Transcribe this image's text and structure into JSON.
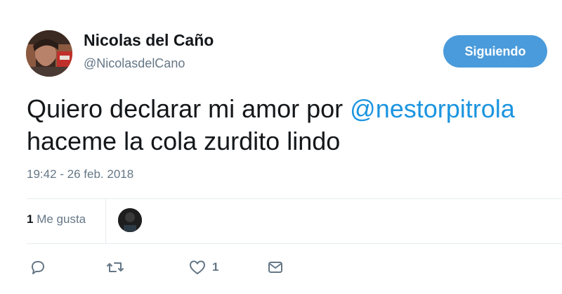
{
  "user": {
    "name": "Nicolas del Caño",
    "handle": "@NicolasdelCano"
  },
  "follow_button": {
    "label": "Siguiendo"
  },
  "tweet": {
    "text_part1": "Quiero declarar mi amor por ",
    "mention": "@nestorpitrola",
    "text_part2": "haceme la cola zurdito lindo",
    "timestamp": "19:42 - 26 feb. 2018"
  },
  "stats": {
    "likes_number": "1",
    "likes_label": " Me gusta"
  },
  "actions": {
    "like_count": "1"
  },
  "icons": [
    "reply-icon",
    "retweet-icon",
    "like-icon",
    "message-icon"
  ],
  "colors": {
    "accent": "#1b95e0",
    "follow_button": "#4a9bdb",
    "muted": "#657786"
  }
}
